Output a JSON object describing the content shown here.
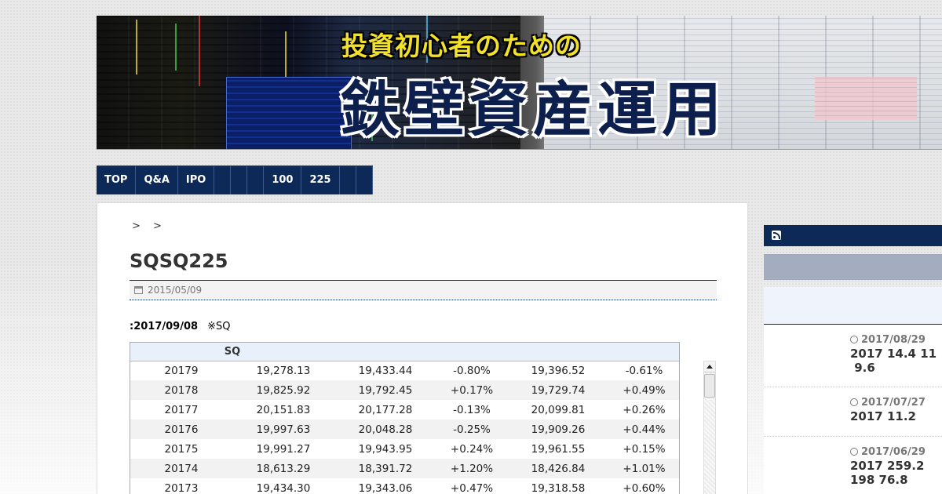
{
  "banner": {
    "subtitle": "投資初心者のための",
    "title": "鉄壁資産運用"
  },
  "nav": {
    "items": [
      "TOP",
      "Q&A",
      "IPO",
      "",
      "",
      "",
      "100",
      "225",
      "",
      ""
    ]
  },
  "breadcrumb": "> >",
  "post": {
    "title": "SQSQ225",
    "date": "2015/05/09",
    "note_date": ":2017/09/08",
    "note_text": "※SQ"
  },
  "table": {
    "header": "SQ",
    "rows": [
      [
        "20179",
        "19,278.13",
        "19,433.44",
        "-0.80%",
        "19,396.52",
        "-0.61%"
      ],
      [
        "20178",
        "19,825.92",
        "19,792.45",
        "+0.17%",
        "19,729.74",
        "+0.49%"
      ],
      [
        "20177",
        "20,151.83",
        "20,177.28",
        "-0.13%",
        "20,099.81",
        "+0.26%"
      ],
      [
        "20176",
        "19,997.63",
        "20,048.28",
        "-0.25%",
        "19,909.26",
        "+0.44%"
      ],
      [
        "20175",
        "19,991.27",
        "19,943.95",
        "+0.24%",
        "19,961.55",
        "+0.15%"
      ],
      [
        "20174",
        "18,613.29",
        "18,391.72",
        "+1.20%",
        "18,426.84",
        "+1.01%"
      ],
      [
        "20173",
        "19,434.30",
        "19,343.06",
        "+0.47%",
        "19,318.58",
        "+0.60%"
      ]
    ]
  },
  "sidebar": {
    "posts": [
      {
        "date": "2017/08/29",
        "title": "2017 14.4 11\n 9.6"
      },
      {
        "date": "2017/07/27",
        "title": "2017 11.2"
      },
      {
        "date": "2017/06/29",
        "title": "2017 259.2\n198 76.8"
      }
    ]
  },
  "colors": {
    "navy": "#0d2957",
    "banner_yellow": "#f2e12b"
  }
}
